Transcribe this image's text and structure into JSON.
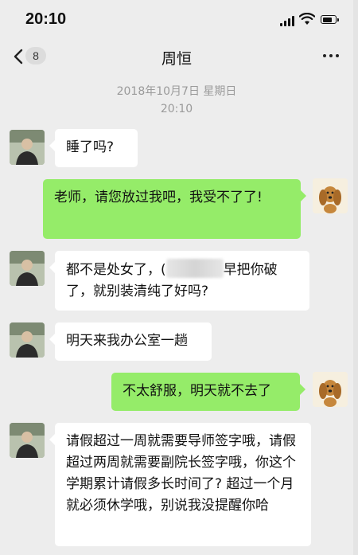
{
  "status_bar": {
    "time": "20:10",
    "battery_level": 0.85
  },
  "nav": {
    "badge_count": "8",
    "title": "周恒"
  },
  "timestamp": {
    "date": "2018年10月7日 星期日",
    "time": "20:10"
  },
  "messages": [
    {
      "from": "contact",
      "text": "睡了吗?"
    },
    {
      "from": "me",
      "text": "老师，请您放过我吧，我受不了了!"
    },
    {
      "from": "contact",
      "text_before": "都不是处女了，",
      "text_obscured_prefix": "(",
      "text_after": "早把你破了，就别装清纯了好吗?"
    },
    {
      "from": "contact",
      "text": "明天来我办公室一趟"
    },
    {
      "from": "me",
      "text": "不太舒服，明天就不去了"
    },
    {
      "from": "contact",
      "text": "请假超过一周就需要导师签字哦，请假超过两周就需要副院长签字哦，你这个学期累计请假多长时间了? 超过一个月就必须休学哦，别说我没提醒你哈"
    }
  ],
  "icons": {
    "back": "chevron-left-icon",
    "more": "more-dots-icon",
    "signal": "signal-icon",
    "wifi": "wifi-icon",
    "battery": "battery-icon",
    "contact_avatar": "person-avatar",
    "my_avatar": "dog-avatar"
  },
  "colors": {
    "outgoing_bubble": "#95ec69",
    "incoming_bubble": "#ffffff",
    "background": "#ededed"
  }
}
